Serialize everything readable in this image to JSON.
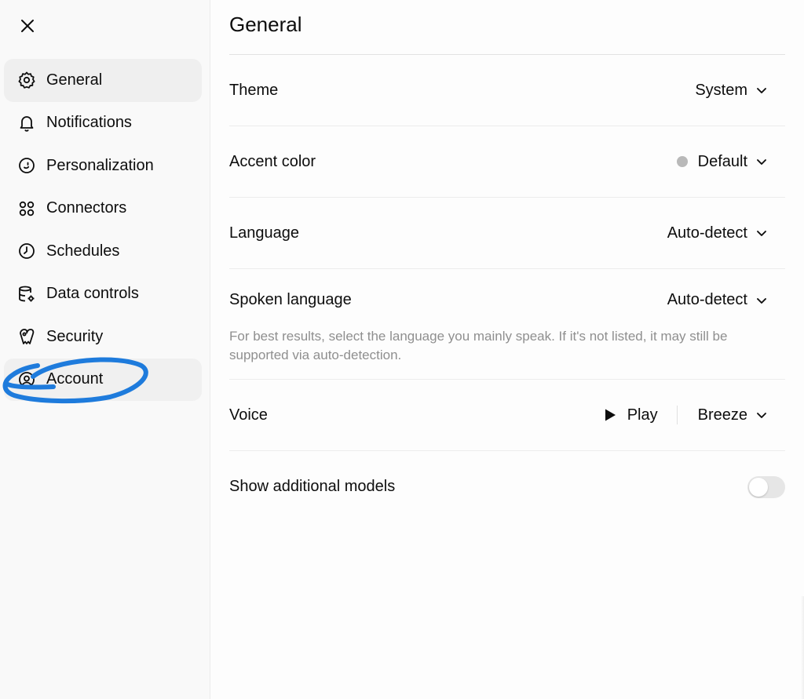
{
  "window": {
    "close_icon": "close-icon"
  },
  "sidebar": {
    "items": [
      {
        "id": "general",
        "label": "General",
        "icon": "gear-icon",
        "active": true
      },
      {
        "id": "notifications",
        "label": "Notifications",
        "icon": "bell-icon"
      },
      {
        "id": "personalization",
        "label": "Personalization",
        "icon": "smile-circle-icon"
      },
      {
        "id": "connectors",
        "label": "Connectors",
        "icon": "connectors-icon"
      },
      {
        "id": "schedules",
        "label": "Schedules",
        "icon": "clock-icon"
      },
      {
        "id": "data-controls",
        "label": "Data controls",
        "icon": "database-gear-icon"
      },
      {
        "id": "security",
        "label": "Security",
        "icon": "shield-key-icon"
      },
      {
        "id": "account",
        "label": "Account",
        "icon": "user-circle-icon",
        "hover": true
      }
    ],
    "annotation_color": "#1e7bdc"
  },
  "main": {
    "title": "General",
    "settings": {
      "theme": {
        "label": "Theme",
        "value": "System"
      },
      "accent_color": {
        "label": "Accent color",
        "value": "Default",
        "swatch": "#b9b9b9"
      },
      "language": {
        "label": "Language",
        "value": "Auto-detect"
      },
      "spoken_language": {
        "label": "Spoken language",
        "value": "Auto-detect",
        "helper": "For best results, select the language you mainly speak. If it's not listed, it may still be supported via auto-detection."
      },
      "voice": {
        "label": "Voice",
        "play_label": "Play",
        "value": "Breeze"
      },
      "additional_models": {
        "label": "Show additional models",
        "enabled": false
      }
    }
  }
}
